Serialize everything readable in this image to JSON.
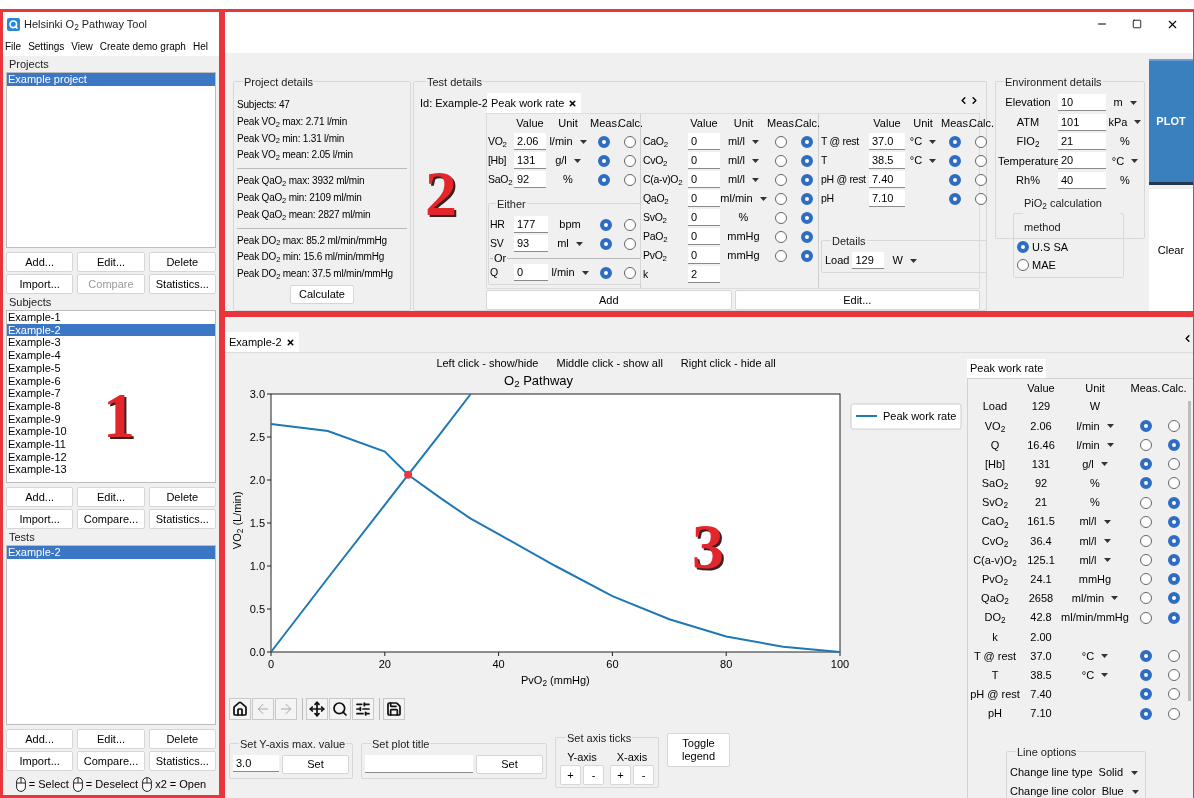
{
  "window": {
    "title": "Helsinki O$_{2}$ Pathway Tool"
  },
  "menu": [
    "File",
    "Settings",
    "View",
    "Create demo graph",
    "Hel"
  ],
  "sidebar": {
    "callout": "1",
    "sections": [
      {
        "title": "Projects",
        "items": [
          {
            "label": "Example project",
            "selected": true
          }
        ],
        "buttons": [
          {
            "label": "Add...",
            "disabled": false
          },
          {
            "label": "Edit...",
            "disabled": false
          },
          {
            "label": "Delete",
            "disabled": false
          },
          {
            "label": "Import...",
            "disabled": false
          },
          {
            "label": "Compare",
            "disabled": true
          },
          {
            "label": "Statistics...",
            "disabled": false
          }
        ]
      },
      {
        "title": "Subjects",
        "items": [
          {
            "label": "Example-1",
            "selected": false
          },
          {
            "label": "Example-2",
            "selected": true
          },
          {
            "label": "Example-3",
            "selected": false
          },
          {
            "label": "Example-4",
            "selected": false
          },
          {
            "label": "Example-5",
            "selected": false
          },
          {
            "label": "Example-6",
            "selected": false
          },
          {
            "label": "Example-7",
            "selected": false
          },
          {
            "label": "Example-8",
            "selected": false
          },
          {
            "label": "Example-9",
            "selected": false
          },
          {
            "label": "Example-10",
            "selected": false
          },
          {
            "label": "Example-11",
            "selected": false
          },
          {
            "label": "Example-12",
            "selected": false
          },
          {
            "label": "Example-13",
            "selected": false
          }
        ],
        "buttons": [
          {
            "label": "Add...",
            "disabled": false
          },
          {
            "label": "Edit...",
            "disabled": false
          },
          {
            "label": "Delete",
            "disabled": false
          },
          {
            "label": "Import...",
            "disabled": false
          },
          {
            "label": "Compare...",
            "disabled": false
          },
          {
            "label": "Statistics...",
            "disabled": false
          }
        ]
      },
      {
        "title": "Tests",
        "items": [
          {
            "label": "Example-2",
            "selected": true
          }
        ],
        "buttons": [
          {
            "label": "Add...",
            "disabled": false
          },
          {
            "label": "Edit...",
            "disabled": false
          },
          {
            "label": "Delete",
            "disabled": false
          },
          {
            "label": "Import...",
            "disabled": false
          },
          {
            "label": "Compare...",
            "disabled": false
          },
          {
            "label": "Statistics...",
            "disabled": false
          }
        ]
      }
    ],
    "mouse_legend": [
      "= Select",
      "= Deselect",
      "x2 = Open"
    ]
  },
  "top": {
    "callout": "2",
    "project_details": {
      "title": "Project details",
      "groups": [
        [
          "Subjects: 47",
          "Peak VO$_{2}$ max: 2.71 l/min",
          "Peak VO$_{2}$ min: 1.31 l/min",
          "Peak VO$_{2}$ mean: 2.05 l/min"
        ],
        [
          "Peak QaO$_{2}$ max: 3932 ml/min",
          "Peak QaO$_{2}$ min: 2109 ml/min",
          "Peak QaO$_{2}$ mean: 2827 ml/min"
        ],
        [
          "Peak DO$_{2}$ max: 85.2 ml/min/mmHg",
          "Peak DO$_{2}$ min: 15.6 ml/min/mmHg",
          "Peak DO$_{2}$ mean: 37.5 ml/min/mmHg"
        ]
      ],
      "button": "Calculate"
    },
    "test_details": {
      "title": "Test details",
      "id": "Id: Example-2",
      "tabs": [
        {
          "label": "Peak work rate",
          "selected": true
        }
      ],
      "blocks": [
        {
          "headers": [
            "Value",
            "Unit",
            "Meas.",
            "Calc."
          ],
          "rows": [
            {
              "label": "VO$_{2}$",
              "value": "2.06",
              "unit": "l/min",
              "dropdown": true,
              "meas": true
            },
            {
              "label": "[Hb]",
              "value": "131",
              "unit": "g/l",
              "dropdown": true,
              "meas": true
            },
            {
              "label": "SaO$_{2}$",
              "value": "92",
              "unit": "%",
              "dropdown": false,
              "meas": true
            }
          ],
          "either": {
            "title": "Either",
            "or": "Or",
            "rows": [
              {
                "label": "HR",
                "value": "177",
                "unit": "bpm",
                "dropdown": false,
                "meas": true
              },
              {
                "label": "SV",
                "value": "93",
                "unit": "ml",
                "dropdown": true,
                "meas": true
              }
            ],
            "or_rows": [
              {
                "label": "Q",
                "value": "0",
                "unit": "l/min",
                "dropdown": true,
                "meas": true
              }
            ]
          }
        },
        {
          "headers": [
            "Value",
            "Unit",
            "Meas.",
            "Calc."
          ],
          "rows": [
            {
              "label": "CaO$_{2}$",
              "value": "0",
              "unit": "ml/l",
              "dropdown": true,
              "meas": false
            },
            {
              "label": "CvO$_{2}$",
              "value": "0",
              "unit": "ml/l",
              "dropdown": true,
              "meas": false
            },
            {
              "label": "C(a-v)O$_{2}$",
              "value": "0",
              "unit": "ml/l",
              "dropdown": true,
              "meas": false
            },
            {
              "label": "QaO$_{2}$",
              "value": "0",
              "unit": "ml/min",
              "dropdown": true,
              "meas": false
            },
            {
              "label": "SvO$_{2}$",
              "value": "0",
              "unit": "%",
              "dropdown": false,
              "meas": false
            },
            {
              "label": "PaO$_{2}$",
              "value": "0",
              "unit": "mmHg",
              "dropdown": false,
              "meas": false
            },
            {
              "label": "PvO$_{2}$",
              "value": "0",
              "unit": "mmHg",
              "dropdown": false,
              "meas": false
            },
            {
              "label": "k",
              "value": "2"
            }
          ]
        },
        {
          "headers": [
            "Value",
            "Unit",
            "Meas.",
            "Calc."
          ],
          "rows": [
            {
              "label": "T @ rest",
              "value": "37.0",
              "unit": "°C",
              "dropdown": true,
              "meas": true
            },
            {
              "label": "T",
              "value": "38.5",
              "unit": "°C",
              "dropdown": true,
              "meas": true
            },
            {
              "label": "pH @ rest",
              "value": "7.40",
              "meas": true
            },
            {
              "label": "pH",
              "value": "7.10",
              "meas": true
            }
          ],
          "details": {
            "title": "Details",
            "label": "Load",
            "value": "129",
            "unit": "W",
            "dropdown": true
          }
        }
      ],
      "buttons": [
        "Add",
        "Edit..."
      ]
    },
    "environment": {
      "title": "Environment details",
      "rows": [
        {
          "label": "Elevation",
          "value": "10",
          "unit": "m",
          "dropdown": true
        },
        {
          "label": "ATM",
          "value": "101",
          "unit": "kPa",
          "dropdown": true
        },
        {
          "label": "FIO$_{2}$",
          "value": "21",
          "unit": "%",
          "dropdown": false
        },
        {
          "label": "Temperature",
          "value": "20",
          "unit": "°C",
          "dropdown": true
        },
        {
          "label": "Rh%",
          "value": "40",
          "unit": "%",
          "dropdown": false
        }
      ],
      "method": {
        "title": "PiO$_{2}$ calculation method",
        "options": [
          {
            "label": "U.S SA",
            "selected": true
          },
          {
            "label": "MAE",
            "selected": false
          }
        ]
      }
    },
    "actions": [
      "PLOT",
      "Clear"
    ]
  },
  "plot": {
    "callout": "3",
    "tabs": [
      {
        "label": "Example-2",
        "selected": true
      }
    ],
    "hints": [
      "Left click - show/hide",
      "Middle click - show all",
      "Right click - hide all"
    ],
    "chart_data": {
      "type": "line",
      "title": "O$_{2}$ Pathway",
      "xlabel": "PvO$_{2}$ (mmHg)",
      "ylabel": "VO$_{2}$ (L/min)",
      "x": [
        0,
        10,
        20,
        24.1,
        30,
        35.1,
        40,
        50,
        60,
        70,
        80,
        90,
        100
      ],
      "series": [
        {
          "name": "Peak work rate",
          "color": "#1f77b4",
          "values": [
            2.65,
            2.57,
            2.33,
            2.06,
            1.78,
            1.55,
            1.37,
            1.0,
            0.65,
            0.38,
            0.18,
            0.06,
            0.0
          ]
        },
        {
          "color": "#1f77b4",
          "values": [
            0,
            0.86,
            1.71,
            2.06,
            2.56,
            3.0,
            null,
            null,
            null,
            null,
            null,
            null,
            null
          ]
        }
      ],
      "xlim": [
        0,
        100
      ],
      "ylim": [
        0,
        3
      ],
      "xticks": [
        {
          "value": 0,
          "label": "0"
        },
        {
          "value": 20,
          "label": "20"
        },
        {
          "value": 40,
          "label": "40"
        },
        {
          "value": 60,
          "label": "60"
        },
        {
          "value": 80,
          "label": "80"
        },
        {
          "value": 100,
          "label": "100"
        }
      ],
      "yticks": [
        {
          "value": 0,
          "label": "0.0"
        },
        {
          "value": 0.5,
          "label": "0.5"
        },
        {
          "value": 1,
          "label": "1.0"
        },
        {
          "value": 1.5,
          "label": "1.5"
        },
        {
          "value": 2,
          "label": "2.0"
        },
        {
          "value": 2.5,
          "label": "2.5"
        },
        {
          "value": 3,
          "label": "3.0"
        }
      ]
    },
    "toolbar": [
      [
        {
          "kind": "home",
          "disabled": false
        },
        {
          "kind": "back",
          "disabled": true
        },
        {
          "kind": "forward",
          "disabled": true
        }
      ],
      [
        {
          "kind": "pan",
          "disabled": false
        },
        {
          "kind": "zoom",
          "disabled": false
        },
        {
          "kind": "configure",
          "disabled": false
        }
      ],
      [
        {
          "kind": "save",
          "disabled": false
        }
      ]
    ],
    "ymax": {
      "title": "Set Y-axis max. value",
      "value": "3.0",
      "button": "Set"
    },
    "plot_title": {
      "title": "Set plot title",
      "button": "Set"
    },
    "ticks": {
      "title": "Set axis ticks",
      "axes": [
        {
          "label": "Y-axis",
          "buttons": [
            "+",
            "-"
          ]
        },
        {
          "label": "X-axis",
          "buttons": [
            "+",
            "-"
          ]
        }
      ]
    },
    "toggle": "Toggle legend",
    "table": {
      "tabs": [
        {
          "label": "Peak work rate",
          "selected": true
        }
      ],
      "headers": [
        "Value",
        "Unit",
        "Meas.",
        "Calc."
      ],
      "rows": [
        {
          "label": "Load",
          "value": "129",
          "unit": "W",
          "dropdown": false
        },
        {
          "label": "VO$_{2}$",
          "value": "2.06",
          "unit": "l/min",
          "dropdown": true,
          "meas": true
        },
        {
          "label": "Q",
          "value": "16.46",
          "unit": "l/min",
          "dropdown": true,
          "meas": false
        },
        {
          "label": "[Hb]",
          "value": "131",
          "unit": "g/l",
          "dropdown": true,
          "meas": true
        },
        {
          "label": "SaO$_{2}$",
          "value": "92",
          "unit": "%",
          "dropdown": false,
          "meas": true
        },
        {
          "label": "SvO$_{2}$",
          "value": "21",
          "unit": "%",
          "dropdown": false,
          "meas": false
        },
        {
          "label": "CaO$_{2}$",
          "value": "161.5",
          "unit": "ml/l",
          "dropdown": true,
          "meas": false
        },
        {
          "label": "CvO$_{2}$",
          "value": "36.4",
          "unit": "ml/l",
          "dropdown": true,
          "meas": false
        },
        {
          "label": "C(a-v)O$_{2}$",
          "value": "125.1",
          "unit": "ml/l",
          "dropdown": true,
          "meas": false
        },
        {
          "label": "PvO$_{2}$",
          "value": "24.1",
          "unit": "mmHg",
          "dropdown": false,
          "meas": false
        },
        {
          "label": "QaO$_{2}$",
          "value": "2658",
          "unit": "ml/min",
          "dropdown": true,
          "meas": false
        },
        {
          "label": "DO$_{2}$",
          "value": "42.8",
          "unit": "ml/min/mmHg",
          "dropdown": false,
          "meas": false
        },
        {
          "label": "k",
          "value": "2.00"
        },
        {
          "label": "T @ rest",
          "value": "37.0",
          "unit": "°C",
          "dropdown": true,
          "meas": true
        },
        {
          "label": "T",
          "value": "38.5",
          "unit": "°C",
          "dropdown": true,
          "meas": true
        },
        {
          "label": "pH @ rest",
          "value": "7.40",
          "meas": true
        },
        {
          "label": "pH",
          "value": "7.10",
          "meas": true
        }
      ],
      "line_options": {
        "title": "Line options",
        "rows": [
          {
            "label": "Change line type",
            "value": "Solid"
          },
          {
            "label": "Change line color",
            "value": "Blue"
          }
        ]
      }
    }
  }
}
